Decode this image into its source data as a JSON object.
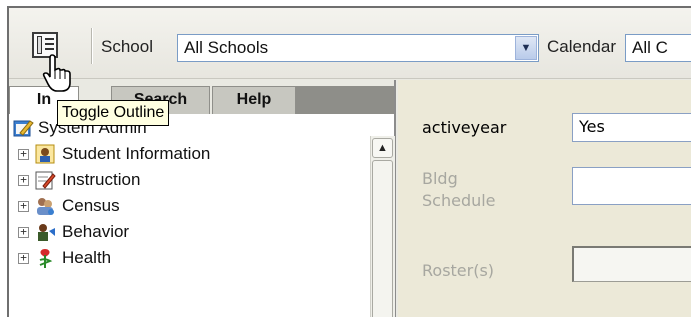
{
  "toolbar": {
    "toggle_outline_tooltip": "Toggle Outline",
    "school_label": "School",
    "school_value": "All Schools",
    "calendar_label": "Calendar",
    "calendar_value": "All C"
  },
  "tabs": [
    {
      "label": "In",
      "active": true
    },
    {
      "label": "Search",
      "active": false
    },
    {
      "label": "Help",
      "active": false
    }
  ],
  "tree": {
    "root": {
      "label": "System Admin",
      "icon": "system-admin-icon"
    },
    "items": [
      {
        "label": "Student Information",
        "icon": "student-information-icon"
      },
      {
        "label": "Instruction",
        "icon": "instruction-icon"
      },
      {
        "label": "Census",
        "icon": "census-icon"
      },
      {
        "label": "Behavior",
        "icon": "behavior-icon"
      },
      {
        "label": "Health",
        "icon": "health-icon"
      }
    ]
  },
  "form": {
    "activeyear_label": "activeyear",
    "activeyear_value": "Yes",
    "bldg_schedule_label_1": "Bldg",
    "bldg_schedule_label_2": "Schedule",
    "roster_label": "Roster(s)"
  },
  "colors": {
    "toolbar_bg": "#e7e6df",
    "form_bg": "#ece9d8",
    "tooltip_bg": "#ffffe1",
    "input_border": "#7a9cc6"
  }
}
